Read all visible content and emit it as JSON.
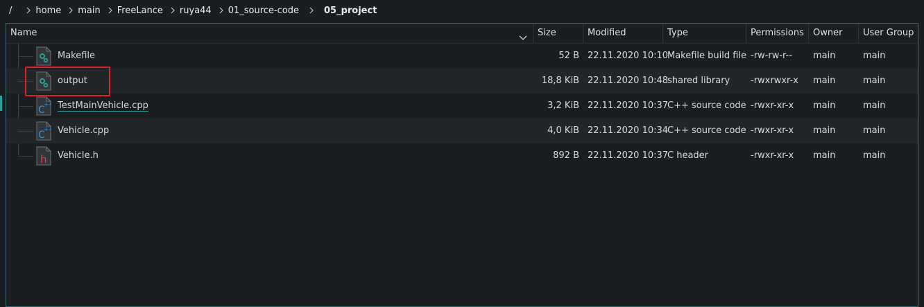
{
  "breadcrumb": {
    "items": [
      "/",
      "home",
      "main",
      "FreeLance",
      "ruya44",
      "01_source-code",
      "05_project"
    ]
  },
  "columns": {
    "name": "Name",
    "size": "Size",
    "modified": "Modified",
    "type": "Type",
    "permissions": "Permissions",
    "owner": "Owner",
    "group": "User Group"
  },
  "files": [
    {
      "name": "Makefile",
      "size": "52 B",
      "modified": "22.11.2020 10:10",
      "type": "Makefile build file",
      "permissions": "-rw-rw-r--",
      "owner": "main",
      "group": "main",
      "icon": "gear-file-icon"
    },
    {
      "name": "output",
      "size": "18,8 KiB",
      "modified": "22.11.2020 10:48",
      "type": "shared library",
      "permissions": "-rwxrwxr-x",
      "owner": "main",
      "group": "main",
      "icon": "gear-file-icon"
    },
    {
      "name": "TestMainVehicle.cpp",
      "size": "3,2 KiB",
      "modified": "22.11.2020 10:37",
      "type": "C++ source code",
      "permissions": "-rwxr-xr-x",
      "owner": "main",
      "group": "main",
      "icon": "cpp-file-icon"
    },
    {
      "name": "Vehicle.cpp",
      "size": "4,0 KiB",
      "modified": "22.11.2020 10:34",
      "type": "C++ source code",
      "permissions": "-rwxr-xr-x",
      "owner": "main",
      "group": "main",
      "icon": "cpp-file-icon"
    },
    {
      "name": "Vehicle.h",
      "size": "892 B",
      "modified": "22.11.2020 10:37",
      "type": "C header",
      "permissions": "-rwxr-xr-x",
      "owner": "main",
      "group": "main",
      "icon": "h-file-icon"
    }
  ],
  "colors": {
    "accent": "#2aa198",
    "highlight_box": "#e0202a",
    "cpp_icon": "#3b8fd4",
    "header_icon": "#d9453f"
  }
}
